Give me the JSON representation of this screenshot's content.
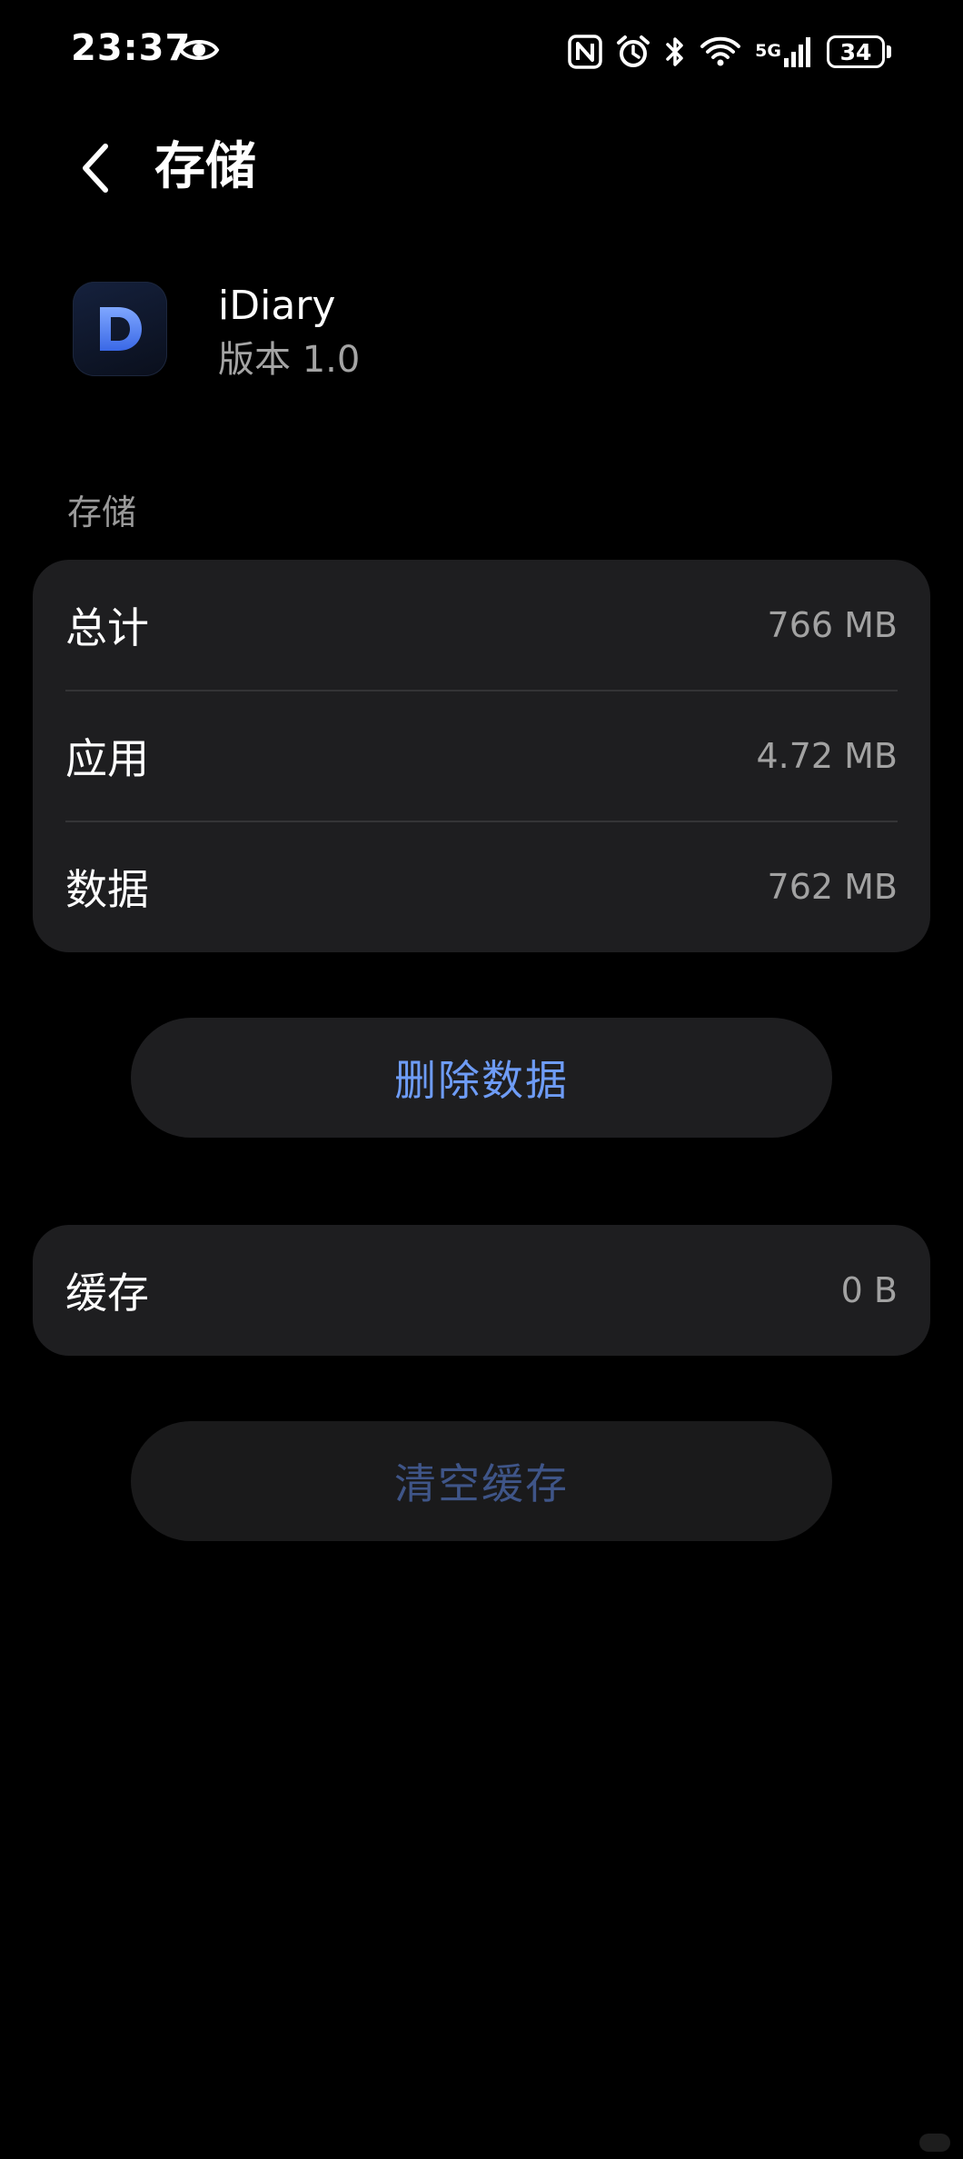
{
  "status_bar": {
    "time": "23:37",
    "network": "5G",
    "battery": "34"
  },
  "header": {
    "title": "存储"
  },
  "app": {
    "name": "iDiary",
    "version": "版本 1.0",
    "icon_letter": "D"
  },
  "storage": {
    "section_label": "存储",
    "rows": [
      {
        "label": "总计",
        "value": "766 MB"
      },
      {
        "label": "应用",
        "value": "4.72 MB"
      },
      {
        "label": "数据",
        "value": "762 MB"
      }
    ]
  },
  "actions": {
    "delete_data": "删除数据",
    "clear_cache": "清空缓存"
  },
  "cache": {
    "label": "缓存",
    "value": "0 B"
  },
  "colors": {
    "background": "#000000",
    "card": "#1e1e20",
    "accent": "#6e9cf6",
    "accent_disabled": "#3f5588",
    "secondary_text": "#a2a2a2"
  },
  "icons": [
    "eye-icon",
    "nfc-icon",
    "alarm-icon",
    "bluetooth-icon",
    "wifi-icon",
    "signal-icon",
    "battery-icon",
    "back-arrow-icon"
  ]
}
